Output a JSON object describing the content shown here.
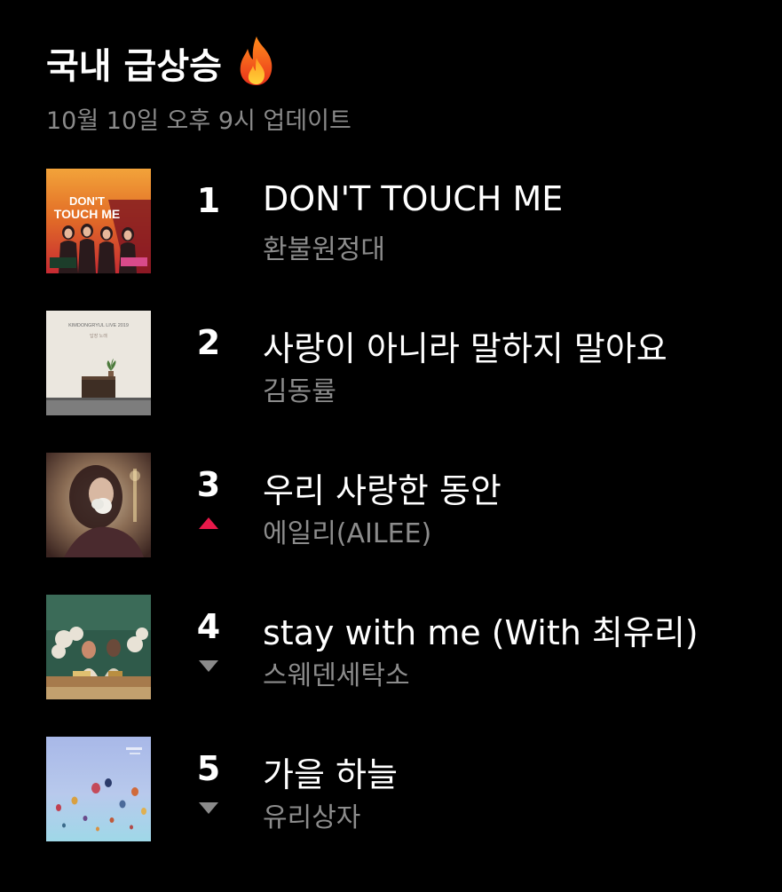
{
  "header": {
    "title": "국내 급상승",
    "subtitle": "10월 10일 오후 9시 업데이트",
    "title_icon": "fire-icon"
  },
  "colors": {
    "background": "#000000",
    "up": "#e8194a",
    "down": "#8a8a8a",
    "subtext": "#8a8a8a"
  },
  "chart": [
    {
      "rank": "1",
      "title": "DON'T TOUCH ME",
      "artist": "환불원정대",
      "trend": "none",
      "cover_text": "DON'T TOUCH ME",
      "cover_icon": "album-cover-image"
    },
    {
      "rank": "2",
      "title": "사랑이 아니라 말하지 말아요",
      "artist": "김동률",
      "trend": "none",
      "cover_text": "KIMDONGRYUL LIVE 2019",
      "cover_icon": "album-cover-image"
    },
    {
      "rank": "3",
      "title": "우리 사랑한 동안",
      "artist": "에일리(AILEE)",
      "trend": "up",
      "cover_icon": "album-cover-image"
    },
    {
      "rank": "4",
      "title": "stay with me (With 최유리)",
      "artist": "스웨덴세탁소",
      "trend": "down",
      "cover_icon": "album-cover-image"
    },
    {
      "rank": "5",
      "title": "가을 하늘",
      "artist": "유리상자",
      "trend": "down",
      "cover_icon": "album-cover-image"
    }
  ]
}
